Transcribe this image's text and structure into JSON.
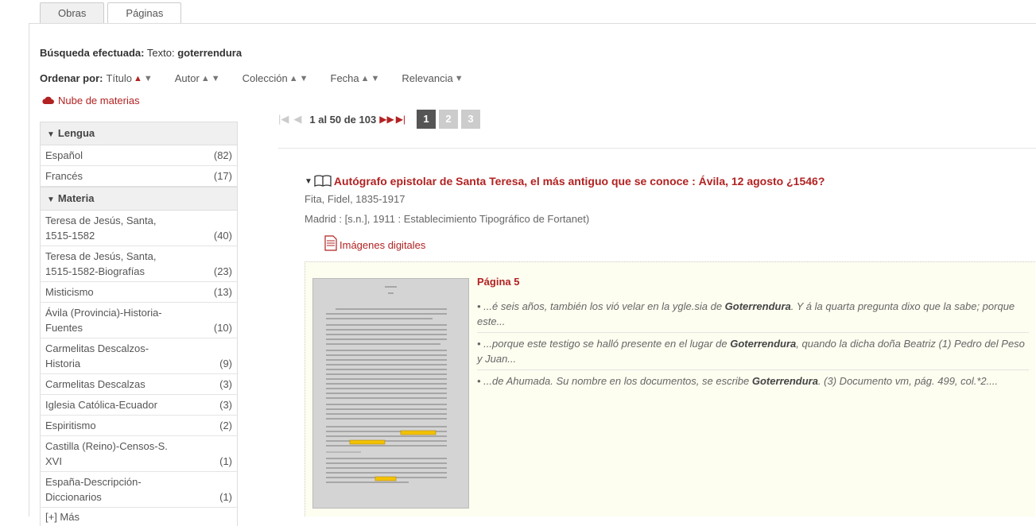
{
  "tabs": [
    {
      "label": "Obras"
    },
    {
      "label": "Páginas"
    }
  ],
  "search": {
    "label": "Búsqueda efectuada:",
    "field": "Texto:",
    "term": "goterrendura"
  },
  "sort": {
    "label": "Ordenar por:",
    "options": [
      {
        "label": "Título"
      },
      {
        "label": "Autor"
      },
      {
        "label": "Colección"
      },
      {
        "label": "Fecha"
      },
      {
        "label": "Relevancia"
      }
    ]
  },
  "cloud_link": "Nube de materias",
  "facets": {
    "lengua": {
      "title": "Lengua",
      "items": [
        {
          "label": "Español",
          "count": "(82)"
        },
        {
          "label": "Francés",
          "count": "(17)"
        }
      ]
    },
    "materia": {
      "title": "Materia",
      "items": [
        {
          "label": "Teresa de Jesús, Santa, 1515-1582",
          "count": "(40)"
        },
        {
          "label": "Teresa de Jesús, Santa, 1515-1582-Biografías",
          "count": "(23)"
        },
        {
          "label": "Misticismo",
          "count": "(13)"
        },
        {
          "label": "Ávila (Provincia)-Historia-Fuentes",
          "count": "(10)"
        },
        {
          "label": "Carmelitas Descalzos-Historia",
          "count": "(9)"
        },
        {
          "label": "Carmelitas Descalzas",
          "count": "(3)"
        },
        {
          "label": "Iglesia Católica-Ecuador",
          "count": "(3)"
        },
        {
          "label": "Espiritismo",
          "count": "(2)"
        },
        {
          "label": "Castilla (Reino)-Censos-S. XVI",
          "count": "(1)"
        },
        {
          "label": "España-Descripción-Diccionarios",
          "count": "(1)"
        }
      ]
    },
    "more": "[+] Más"
  },
  "pager": {
    "range": "1 al 50 de 103",
    "pages": [
      "1",
      "2",
      "3"
    ]
  },
  "result": {
    "title": "Autógrafo epistolar de Santa Teresa, el más antiguo que se conoce : Ávila, 12 agosto ¿1546?",
    "author": "Fita, Fidel, 1835-1917",
    "imprint": "Madrid : [s.n.], 1911 : Establecimiento Tipográfico de Fortanet)",
    "digital_link": "Imágenes digitales",
    "page_label": "Página 5",
    "snippets": [
      {
        "pre": "• ...é seis años, también los vió velar en la ygle.sia de ",
        "term": "Goterrendura",
        "post": ". Y á la quarta pregunta dixo que la sabe; porque este..."
      },
      {
        "pre": "• ...porque este testigo se halló presente en el lugar de ",
        "term": "Goterrendura",
        "post": ", quando la dicha doña Beatriz (1) Pedro del Peso y Juan..."
      },
      {
        "pre": "• ...de Ahumada. Su nombre en los documentos, se escribe ",
        "term": "Goterrendura",
        "post": ". (3) Documento vm, pág. 499, col.*2...."
      }
    ]
  },
  "colors": {
    "accent": "#b22222",
    "facet_bg": "#f0f0f0",
    "snippet_bg": "#fdfdf0"
  }
}
